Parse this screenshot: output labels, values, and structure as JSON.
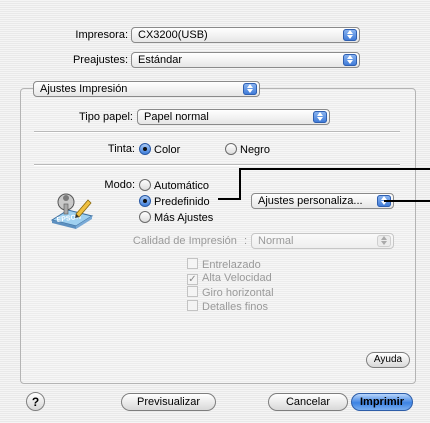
{
  "printer": {
    "label": "Impresora:",
    "value": "CX3200(USB)"
  },
  "presets": {
    "label": "Preajustes:",
    "value": "Estándar"
  },
  "panel": {
    "value": "Ajustes Impresión"
  },
  "paper_type": {
    "label": "Tipo papel:",
    "value": "Papel normal"
  },
  "ink": {
    "label": "Tinta:",
    "options": [
      "Color",
      "Negro"
    ],
    "selected": "Color"
  },
  "mode": {
    "label": "Modo:",
    "options": [
      "Automático",
      "Predefinido",
      "Más Ajustes"
    ],
    "selected": "Predefinido",
    "preset_value": "Ajustes personaliza..."
  },
  "quality": {
    "label": "Calidad de Impresión",
    "separator": ":",
    "value": "Normal"
  },
  "checkboxes": [
    {
      "label": "Entrelazado",
      "checked": false
    },
    {
      "label": "Alta Velocidad",
      "checked": true
    },
    {
      "label": "Giro horizontal",
      "checked": false
    },
    {
      "label": "Detalles finos",
      "checked": false
    }
  ],
  "buttons": {
    "help_glyph": "?",
    "ayuda": "Ayuda",
    "preview": "Previsualizar",
    "cancel": "Cancelar",
    "print": "Imprimir"
  },
  "colors": {
    "accent": "#3d83e3",
    "disabled_text": "#9a9a9a"
  },
  "icons": {
    "mode_icon": "epson-printer-logo-icon"
  }
}
